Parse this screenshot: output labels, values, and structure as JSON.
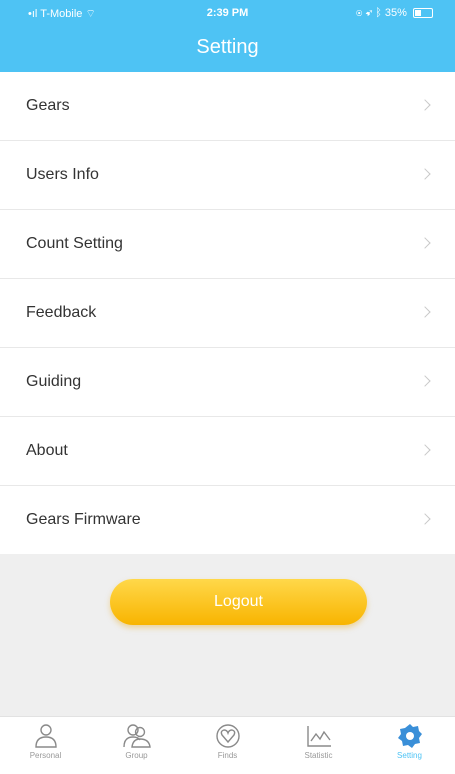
{
  "status_bar": {
    "carrier": "T-Mobile",
    "time": "2:39 PM",
    "battery": "35%"
  },
  "header": {
    "title": "Setting"
  },
  "menu": {
    "items": [
      {
        "label": "Gears"
      },
      {
        "label": "Users Info"
      },
      {
        "label": "Count Setting"
      },
      {
        "label": "Feedback"
      },
      {
        "label": "Guiding"
      },
      {
        "label": "About"
      },
      {
        "label": "Gears Firmware"
      }
    ]
  },
  "logout": {
    "label": "Logout"
  },
  "tabbar": {
    "tabs": [
      {
        "label": "Personal",
        "icon": "person-icon"
      },
      {
        "label": "Group",
        "icon": "group-icon"
      },
      {
        "label": "Finds",
        "icon": "heart-icon"
      },
      {
        "label": "Statistic",
        "icon": "chart-icon"
      },
      {
        "label": "Setting",
        "icon": "gear-icon"
      }
    ],
    "active": "Setting"
  },
  "colors": {
    "header": "#4ec3f4",
    "logout_gradient_top": "#ffd84a",
    "logout_gradient_bottom": "#f8b400",
    "background": "#efefef"
  }
}
